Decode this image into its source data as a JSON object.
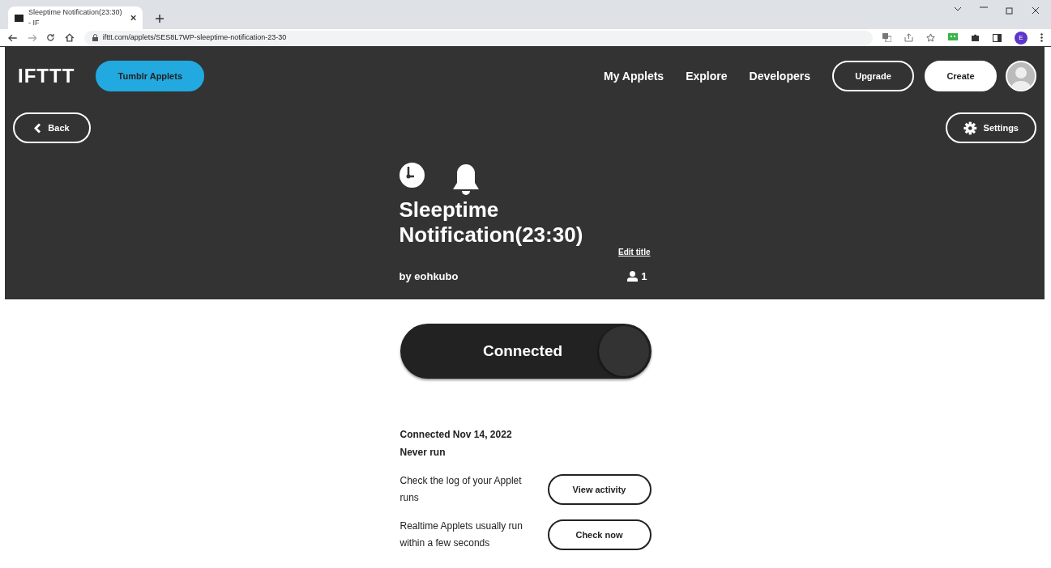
{
  "browser": {
    "tab_title": "Sleeptime Notification(23:30) - IF",
    "url": "ifttt.com/applets/SES8L7WP-sleeptime-notification-23-30",
    "profile_initial": "E"
  },
  "header": {
    "logo": "IFTTT",
    "service_button": "Tumblr Applets",
    "nav": [
      "My Applets",
      "Explore",
      "Developers"
    ],
    "upgrade": "Upgrade",
    "create": "Create",
    "back": "Back",
    "settings": "Settings"
  },
  "applet": {
    "title": "Sleeptime Notification(23:30)",
    "edit_title": "Edit title",
    "author": "by eohkubo",
    "users": "1"
  },
  "toggle": {
    "label": "Connected",
    "on": true
  },
  "status": [
    "Connected Nov 14, 2022",
    "Never run"
  ],
  "actions": [
    {
      "text": "Check the log of your Applet runs",
      "button": "View activity"
    },
    {
      "text": "Realtime Applets usually run within a few seconds",
      "button": "Check now"
    }
  ]
}
